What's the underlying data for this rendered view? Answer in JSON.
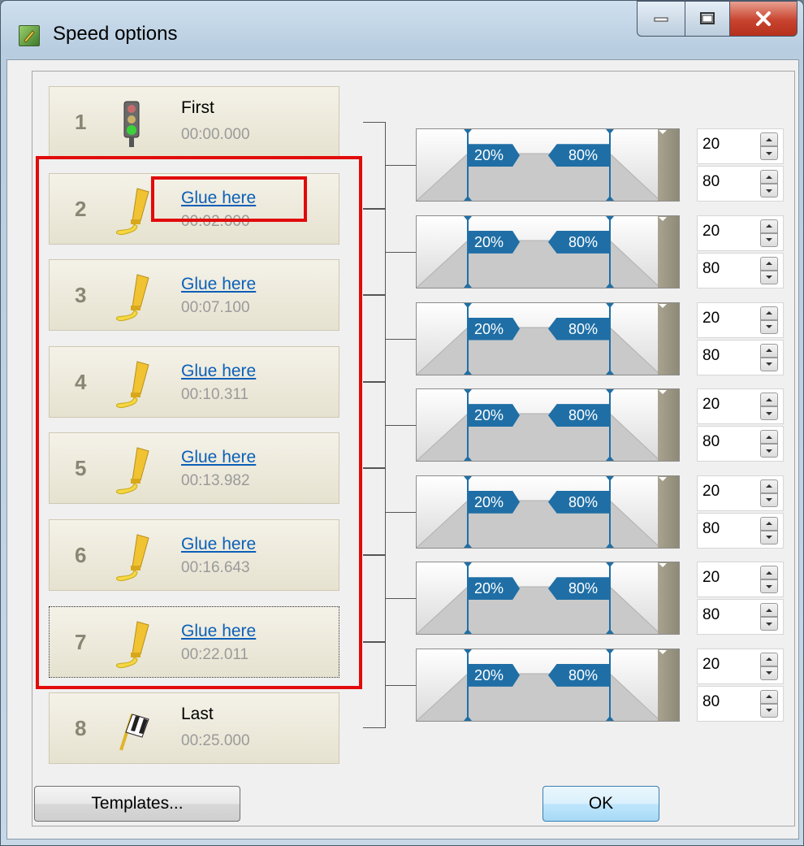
{
  "window": {
    "title": "Speed options"
  },
  "slides": [
    {
      "number": "1",
      "title": "First",
      "link": "",
      "time": "00:00.000",
      "icon": "traffic-light-icon"
    },
    {
      "number": "2",
      "title": "",
      "link": "Glue here",
      "time": "00:02.000",
      "icon": "glue-icon"
    },
    {
      "number": "3",
      "title": "",
      "link": "Glue here",
      "time": "00:07.100",
      "icon": "glue-icon"
    },
    {
      "number": "4",
      "title": "",
      "link": "Glue here",
      "time": "00:10.311",
      "icon": "glue-icon"
    },
    {
      "number": "5",
      "title": "",
      "link": "Glue here",
      "time": "00:13.982",
      "icon": "glue-icon"
    },
    {
      "number": "6",
      "title": "",
      "link": "Glue here",
      "time": "00:16.643",
      "icon": "glue-icon"
    },
    {
      "number": "7",
      "title": "",
      "link": "Glue here",
      "time": "00:22.011",
      "icon": "glue-icon"
    },
    {
      "number": "8",
      "title": "Last",
      "link": "",
      "time": "00:25.000",
      "icon": "checkered-flag-icon"
    }
  ],
  "transitions": [
    {
      "in_label": "20%",
      "out_label": "80%",
      "in_value": "20",
      "out_value": "80"
    },
    {
      "in_label": "20%",
      "out_label": "80%",
      "in_value": "20",
      "out_value": "80"
    },
    {
      "in_label": "20%",
      "out_label": "80%",
      "in_value": "20",
      "out_value": "80"
    },
    {
      "in_label": "20%",
      "out_label": "80%",
      "in_value": "20",
      "out_value": "80"
    },
    {
      "in_label": "20%",
      "out_label": "80%",
      "in_value": "20",
      "out_value": "80"
    },
    {
      "in_label": "20%",
      "out_label": "80%",
      "in_value": "20",
      "out_value": "80"
    },
    {
      "in_label": "20%",
      "out_label": "80%",
      "in_value": "20",
      "out_value": "80"
    }
  ],
  "buttons": {
    "templates": "Templates...",
    "ok": "OK"
  },
  "colors": {
    "highlight": "#e10b0b",
    "tag": "#1f6fa6",
    "link": "#0b5fb8"
  }
}
